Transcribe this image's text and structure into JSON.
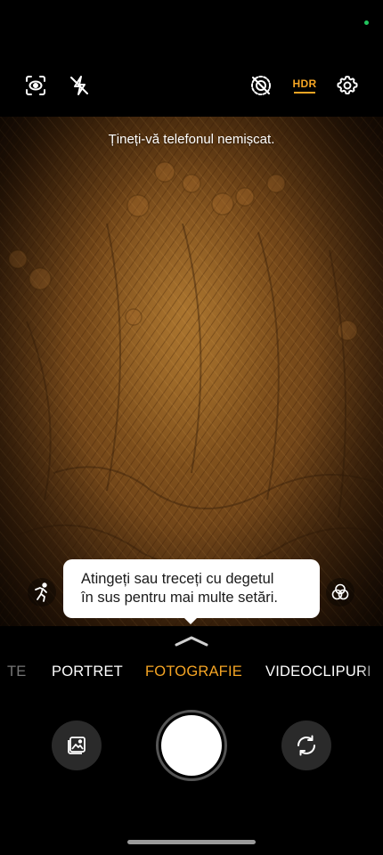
{
  "status": {
    "dot_color": "#22c55e"
  },
  "toolbar": {
    "icons": {
      "left1": "screen-recognition-icon",
      "left2": "flash-off-icon",
      "right1": "motion-photo-off-icon",
      "right2": "hdr-icon",
      "right3": "settings-gear-icon"
    },
    "hdr_label": "HDR",
    "hdr_color": "#f5a524"
  },
  "viewfinder": {
    "hint": "Țineți-vă telefonul nemișcat."
  },
  "side_buttons": {
    "left_icon": "motion-figure-icon",
    "right_icon": "filters-icon"
  },
  "tooltip": {
    "line1": "Atingeți sau treceți cu degetul",
    "line2": "în sus pentru mai multe setări."
  },
  "modes": {
    "items": [
      "TE",
      "PORTRET",
      "FOTOGRAFIE",
      "VIDEOCLIPURI"
    ],
    "selected": "FOTOGRAFIE",
    "accent_color": "#f5a524"
  },
  "bottom": {
    "gallery_icon": "gallery-icon",
    "shutter": "shutter-button",
    "switch_icon": "switch-camera-icon"
  }
}
